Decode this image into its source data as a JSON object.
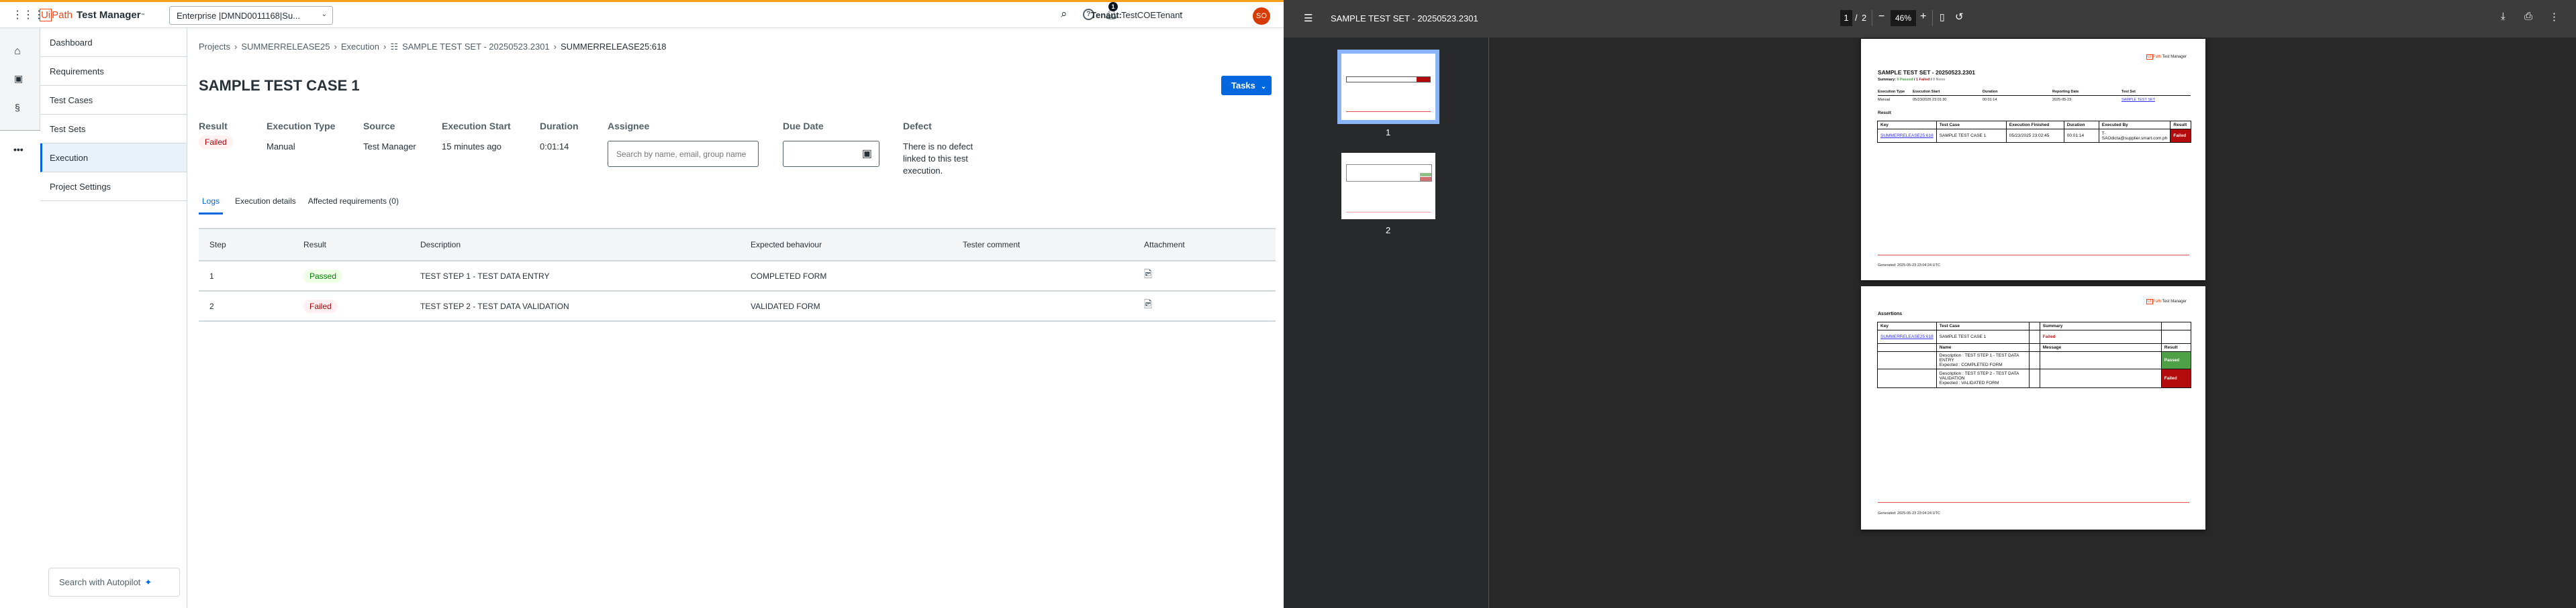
{
  "app": {
    "brand_ui": "Ui",
    "brand_path": "Path",
    "product": "Test Manager",
    "tm": "™",
    "org_selector": "Enterprise |DMND0011168|Su...",
    "tenant_label": "Tenant:",
    "tenant": "TestCOETenant",
    "avatar": "SO",
    "notification_count": "1",
    "accent": "#0067df",
    "top_border": "#fa9f1b"
  },
  "nav": {
    "items": [
      {
        "label": "Dashboard"
      },
      {
        "label": "Requirements"
      },
      {
        "label": "Test Cases"
      },
      {
        "label": "Test Sets"
      },
      {
        "label": "Execution",
        "active": true
      },
      {
        "label": "Project Settings"
      }
    ],
    "autopilot": "Search with Autopilot"
  },
  "breadcrumb": [
    "Projects",
    "SUMMERRELEASE25",
    "Execution",
    "SAMPLE TEST SET - 20250523.2301",
    "SUMMERRELEASE25:618"
  ],
  "page": {
    "title": "SAMPLE TEST CASE 1",
    "tasks_button": "Tasks"
  },
  "fields": {
    "result_label": "Result",
    "result": "Failed",
    "exec_type_label": "Execution Type",
    "exec_type": "Manual",
    "source_label": "Source",
    "source": "Test Manager",
    "start_label": "Execution Start",
    "start": "15 minutes ago",
    "duration_label": "Duration",
    "duration": "0:01:14",
    "assignee_label": "Assignee",
    "assignee_placeholder": "Search by name, email, group name",
    "due_label": "Due Date",
    "due_value": "",
    "defect_label": "Defect",
    "defect": "There is no defect linked to this test execution."
  },
  "tabs": [
    {
      "label": "Logs",
      "active": true
    },
    {
      "label": "Execution details"
    },
    {
      "label": "Affected requirements (0)"
    }
  ],
  "logs": {
    "columns": [
      "Step",
      "Result",
      "Description",
      "Expected behaviour",
      "Tester comment",
      "Attachment"
    ],
    "rows": [
      {
        "step": "1",
        "result": "Passed",
        "description": "TEST STEP 1 - TEST DATA ENTRY",
        "expected": "COMPLETED FORM",
        "comment": ""
      },
      {
        "step": "2",
        "result": "Failed",
        "description": "TEST STEP 2 - TEST DATA VALIDATION",
        "expected": "VALIDATED FORM",
        "comment": ""
      }
    ]
  },
  "pdf": {
    "title": "SAMPLE TEST SET - 20250523.2301",
    "page_current": "1",
    "page_sep": "/",
    "page_total": "2",
    "zoom": "46%",
    "thumb_labels": [
      "1",
      "2"
    ],
    "p1": {
      "logo": "Test Manager",
      "title": "SAMPLE TEST SET - 20250523.2301",
      "summary_label": "Summary:",
      "summary_passed": "0 Passed",
      "summary_failed": "1 Failed",
      "summary_none": "0 None",
      "slash": " / ",
      "info_headers": [
        "Execution Type",
        "Execution Start",
        "Duration",
        "Reporting Date",
        "Test Set"
      ],
      "info_values": [
        "Manual",
        "05/23/2025 23:01:30",
        "00:01:14",
        "2025-05-23",
        "SAMPLE TEST SET"
      ],
      "result_heading": "Result",
      "result_headers": [
        "Key",
        "Test Case",
        "Execution Finished",
        "Duration",
        "Executed By",
        "Result"
      ],
      "result_row": [
        "SUMMERRELEASE25:618",
        "SAMPLE TEST CASE 1",
        "05/23/2025 23:02:45",
        "00:01:14",
        "T-SAOdicta@supplier.smart.com.ph",
        "Failed"
      ],
      "generated": "Generated: 2025-05-23 23:04:24 UTC"
    },
    "p2": {
      "heading": "Assertions",
      "headers": [
        "Key",
        "Test Case",
        "Summary"
      ],
      "key": "SUMMERRELEASE25:618",
      "test_case": "SAMPLE TEST CASE 1",
      "summary": "Failed",
      "sub_headers": [
        "Name",
        "Message",
        "Result"
      ],
      "rows": [
        {
          "name1": "Description : TEST STEP 1 - TEST DATA ENTRY",
          "name2": "Expected : COMPLETED FORM",
          "result": "Passed"
        },
        {
          "name1": "Description : TEST STEP 2 - TEST DATA VALIDATION",
          "name2": "Expected : VALIDATED FORM",
          "result": "Failed"
        }
      ],
      "generated": "Generated: 2025-05-23 23:04:24 UTC"
    }
  }
}
